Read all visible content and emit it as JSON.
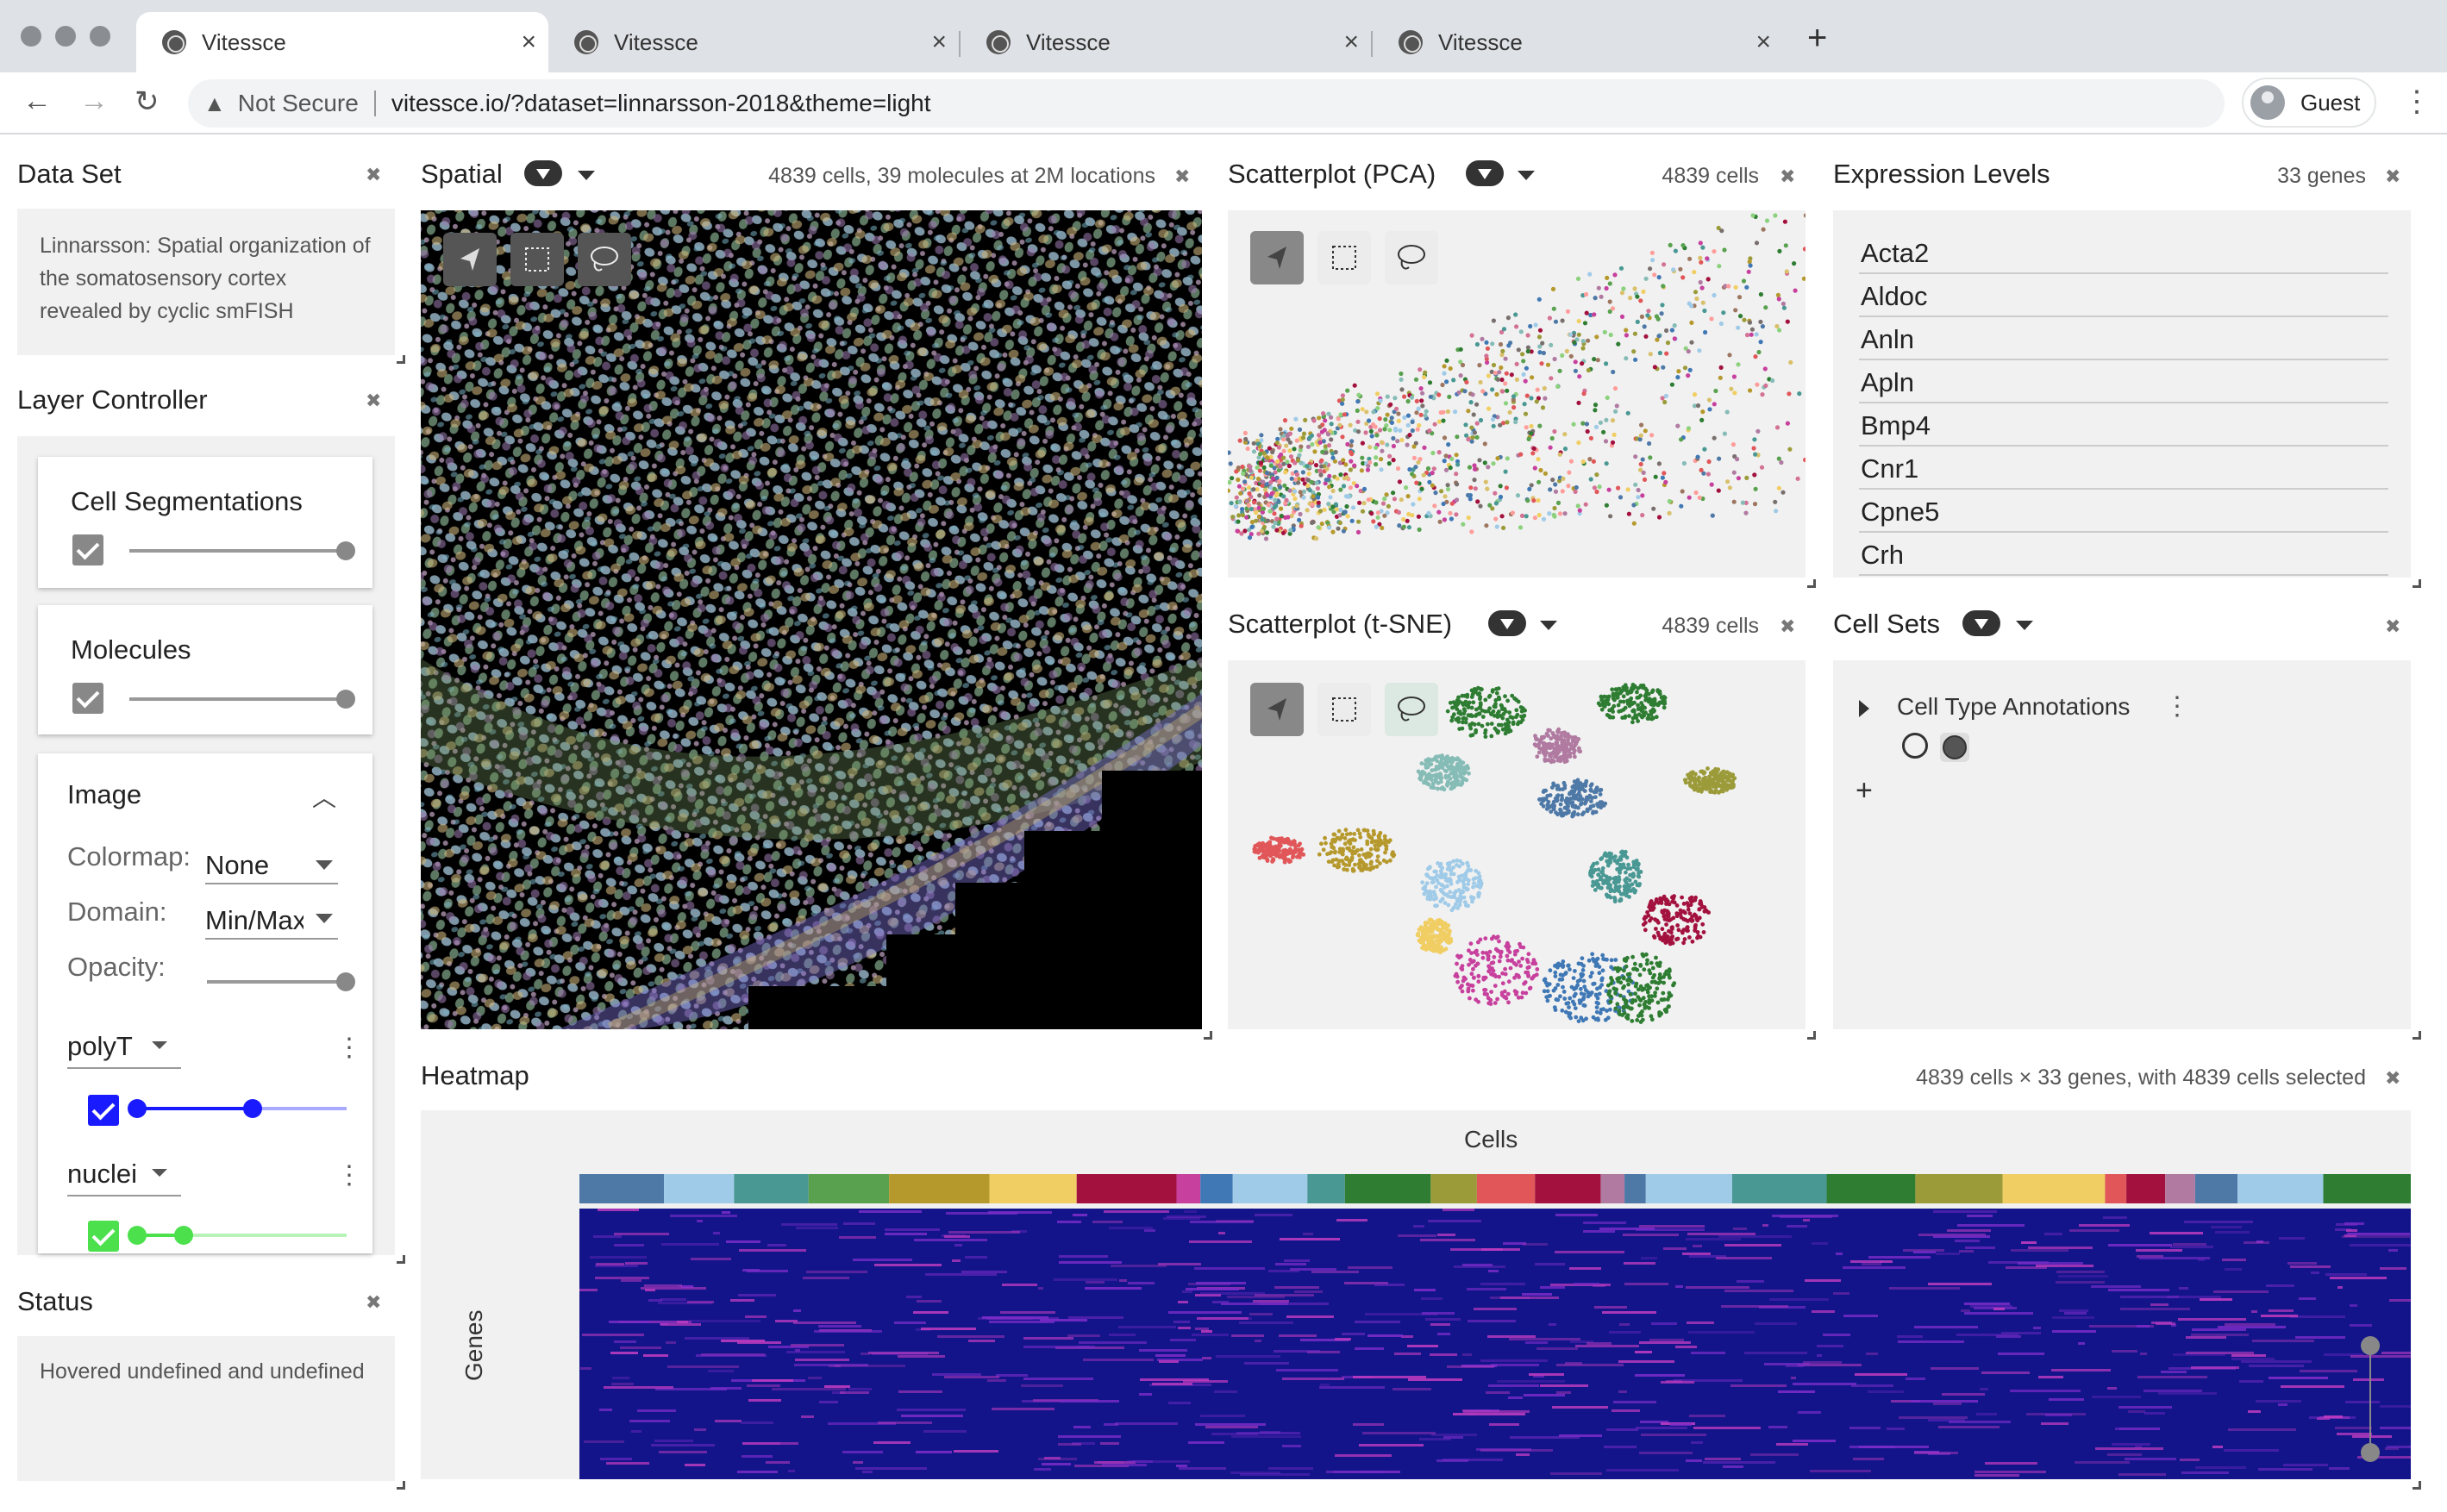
{
  "browser": {
    "tabs": [
      {
        "title": "Vitessce",
        "active": true
      },
      {
        "title": "Vitessce",
        "active": false
      },
      {
        "title": "Vitessce",
        "active": false
      },
      {
        "title": "Vitessce",
        "active": false
      }
    ],
    "not_secure": "Not Secure",
    "url": "vitessce.io/?dataset=linnarsson-2018&theme=light",
    "profile": "Guest"
  },
  "dataset": {
    "title": "Data Set",
    "description": "Linnarsson: Spatial organization of the somatosensory cortex revealed by cyclic smFISH"
  },
  "layer_controller": {
    "title": "Layer Controller",
    "cell_segmentations": {
      "label": "Cell Segmentations",
      "checked": true,
      "opacity": 1.0
    },
    "molecules": {
      "label": "Molecules",
      "checked": true,
      "opacity": 1.0
    },
    "image": {
      "label": "Image",
      "colormap_label": "Colormap:",
      "colormap_value": "None",
      "domain_label": "Domain:",
      "domain_value": "Min/Max",
      "opacity_label": "Opacity:",
      "opacity": 1.0,
      "channels": [
        {
          "name": "polyT",
          "color": "#1a1aff",
          "checked": true,
          "range": [
            0.0,
            0.55
          ]
        },
        {
          "name": "nuclei",
          "color": "#4ce04c",
          "checked": true,
          "range": [
            0.0,
            0.21
          ]
        }
      ]
    }
  },
  "status": {
    "title": "Status",
    "text": "Hovered undefined and undefined"
  },
  "spatial": {
    "title": "Spatial",
    "subtitle": "4839 cells, 39 molecules at 2M locations"
  },
  "scatter_pca": {
    "title": "Scatterplot (PCA)",
    "subtitle": "4839 cells"
  },
  "scatter_tsne": {
    "title": "Scatterplot (t-SNE)",
    "subtitle": "4839 cells"
  },
  "expression": {
    "title": "Expression Levels",
    "subtitle": "33 genes",
    "genes": [
      "Acta2",
      "Aldoc",
      "Anln",
      "Apln",
      "Bmp4",
      "Cnr1",
      "Cpne5",
      "Crh"
    ]
  },
  "cell_sets": {
    "title": "Cell Sets",
    "tree_label": "Cell Type Annotations",
    "add": "+"
  },
  "heatmap": {
    "title": "Heatmap",
    "subtitle": "4839 cells × 33 genes, with 4839 cells selected",
    "x_label": "Cells",
    "y_label": "Genes"
  },
  "colors": {
    "cluster_palette": [
      "#4e79a7",
      "#a0cbe8",
      "#59a14f",
      "#8cd17d",
      "#b6992d",
      "#f1ce63",
      "#499894",
      "#86bcb6",
      "#e15759",
      "#ff9d9a",
      "#79706e",
      "#d37295",
      "#b07aa1",
      "#9d7660",
      "#2e7d32",
      "#a3113e",
      "#c7409d",
      "#3f78b5",
      "#9b9b3a",
      "#d9c06b"
    ],
    "heatmap_bg": "#14148a"
  }
}
